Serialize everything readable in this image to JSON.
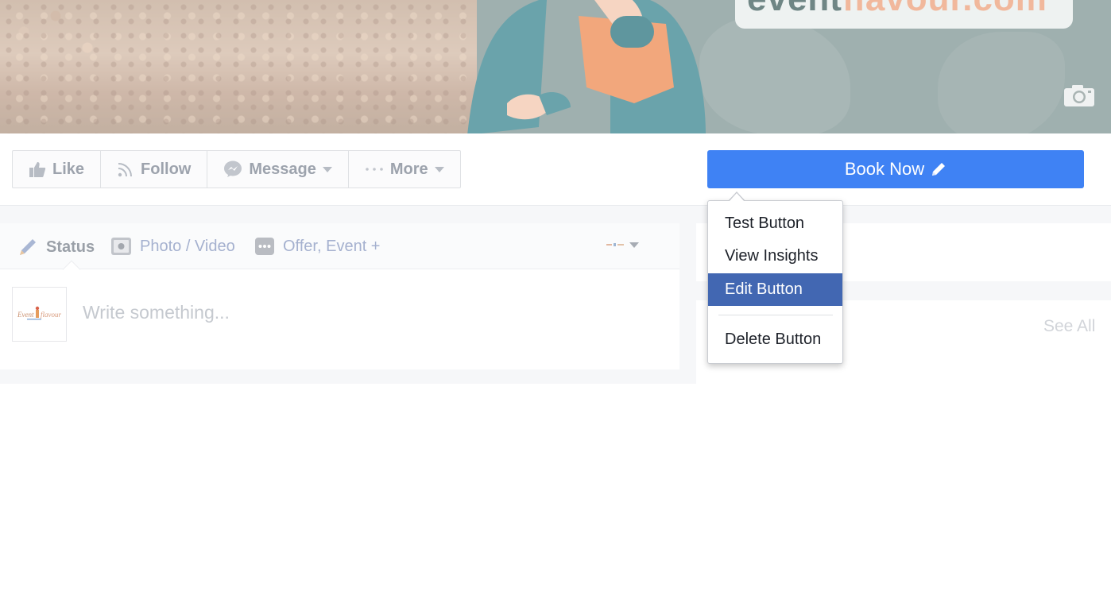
{
  "cover": {
    "domain_part1": "event",
    "domain_part2": "flavour.com",
    "camera_icon": "camera-icon"
  },
  "actions": {
    "like": "Like",
    "follow": "Follow",
    "message": "Message",
    "more": "More"
  },
  "cta": {
    "label": "Book Now",
    "icon": "pencil-icon"
  },
  "dropdown": {
    "items": [
      "Test Button",
      "View Insights",
      "Edit Button",
      "Delete Button"
    ],
    "selected": "Edit Button"
  },
  "composer": {
    "tab_status": "Status",
    "tab_photo": "Photo / Video",
    "tab_offer": "Offer, Event +",
    "placeholder": "Write something..."
  },
  "sidebar": {
    "see_all": "See All"
  },
  "colors": {
    "cta_blue": "#3f82f4",
    "menu_selected": "#4267b2"
  }
}
